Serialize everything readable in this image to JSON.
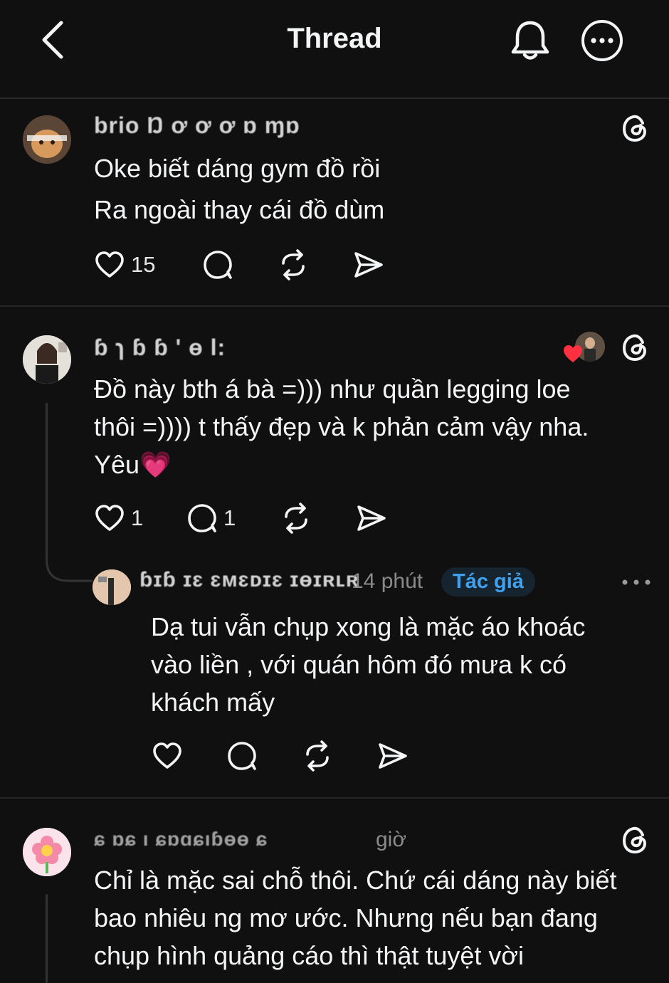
{
  "header": {
    "title": "Thread"
  },
  "posts": [
    {
      "username": "brio Ŋ ơ ơ ơ ɒ   ɱɒ",
      "text_lines": [
        "Oke biết dáng gym đồ rồi",
        "Ra ngoài thay cái đồ dùm"
      ],
      "likes": "15"
    },
    {
      "username": "ɓ ɿ ɓ ɓ ' ɵ l:",
      "text_lines": [
        "Đồ này bth á bà =))) như quần legging loe",
        "thôi =)))) t thấy đẹp và k phản cảm vậy nha.",
        "Yêu💗"
      ],
      "likes": "1",
      "replies": "1",
      "reply": {
        "username": "ɓɪɓ ɪɛ ɛᴍɛᴅɪɛ ɪɵɪʀʟʀ",
        "time": "14 phút",
        "badge": "Tác giả",
        "text_lines": [
          "Dạ tui vẫn chụp xong là mặc áo khoác",
          "vào liền , với quán hôm đó mưa k có",
          "khách mấy"
        ]
      }
    },
    {
      "username": "ɕ   ɒɕ ı ɕɒɑɕıɓɵɵ ɕ",
      "time": "giờ",
      "text_lines": [
        "Chỉ là mặc sai chỗ thôi. Chứ cái dáng này biết",
        "bao nhiêu ng mơ ước. Nhưng nếu bạn đang",
        "chụp hình quảng cáo thì thật tuyệt vời"
      ]
    }
  ],
  "icons": {
    "back": "chevron-left-icon",
    "bell": "bell-icon",
    "more": "more-horizontal-icon",
    "like": "heart-icon",
    "reply": "comment-icon",
    "repost": "repost-icon",
    "share": "send-icon",
    "threads": "threads-logo-icon"
  },
  "colors": {
    "background": "#101010",
    "text": "#f3f5f7",
    "muted": "#8a8a8a",
    "author_badge": "#3fa2f0"
  }
}
